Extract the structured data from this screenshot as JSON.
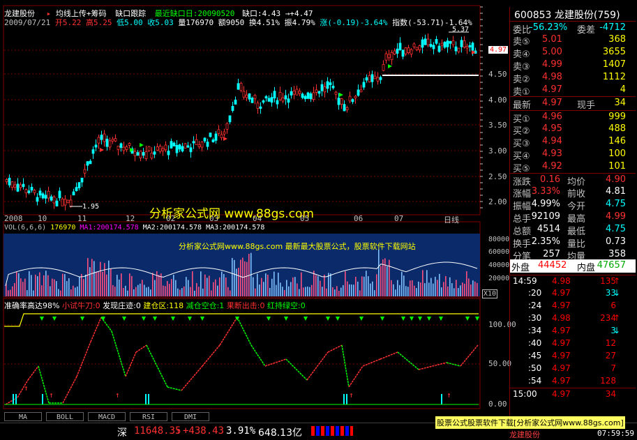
{
  "header": {
    "stock_name": "龙建股份",
    "formula": "均线上传+筹码",
    "gap_track": "缺口跟踪",
    "recent_gap_label": "最近缺口日:20090520",
    "gap_value": "缺口:4.43 →+4.47",
    "date": "2009/07/21",
    "open": "开5.22",
    "high": "高5.25",
    "low": "低5.00",
    "close": "收5.03",
    "volume": "量176970",
    "amount": "额9050",
    "turnover": "换4.51%",
    "amplitude": "振4.79%",
    "change": "涨(-0.19)-3.64%",
    "index": "指数(-53.71)-1.64%"
  },
  "price_axis": [
    "5.37",
    "4.97",
    "4.50",
    "4.00",
    "3.50",
    "3.00",
    "2.50",
    "2.00"
  ],
  "price_markers": {
    "high_label": "5.37",
    "low_label": "1.95",
    "current_tag": "4.97"
  },
  "time_axis": [
    "2008",
    "10",
    "11",
    "12",
    "02",
    "03",
    "04",
    "05",
    "06",
    "07",
    "日线"
  ],
  "watermark": {
    "main": "分析家公式网 www.88gs.com",
    "sub": "分析家公式网www.88gs.com 最新最大股票公式，股票软件下载网站"
  },
  "volume_panel": {
    "legend": {
      "vol": "VOL(6,6,6)",
      "vol_val": "176970",
      "ma1": "MA1:200174.578",
      "ma2": "MA2:200174.578",
      "ma3": "MA3:200174.578"
    },
    "axis": [
      "80000",
      "60000",
      "40000",
      "20000",
      "X10"
    ]
  },
  "indicator_panel": {
    "legend": {
      "title": "准确率高达98%",
      "a": "小试牛刀:0",
      "b": "发现庄迹:0",
      "c": "建仓区:118",
      "d": "减仓空仓:1",
      "e": "果断出击:0",
      "f": "红持绿空:0"
    },
    "axis": [
      "100.00",
      "50.00",
      "0.00"
    ]
  },
  "tabs": [
    "MA",
    "BOLL",
    "MACD",
    "RSI",
    "DMI"
  ],
  "quote": {
    "code_name": "600853 龙建股份(759)",
    "wei_bi_label": "委比",
    "wei_bi": "-56.23%",
    "wei_cha_label": "委差",
    "wei_cha": "-4712",
    "sells": [
      {
        "label": "卖⑤",
        "price": "5.01",
        "vol": "368"
      },
      {
        "label": "卖④",
        "price": "5.00",
        "vol": "3655"
      },
      {
        "label": "卖③",
        "price": "4.99",
        "vol": "1407"
      },
      {
        "label": "卖②",
        "price": "4.98",
        "vol": "1112"
      },
      {
        "label": "卖①",
        "price": "4.97",
        "vol": "4"
      }
    ],
    "latest_label": "最新",
    "latest": "4.97",
    "now_hand_label": "现手",
    "now_hand": "34",
    "buys": [
      {
        "label": "买①",
        "price": "4.96",
        "vol": "999"
      },
      {
        "label": "买②",
        "price": "4.95",
        "vol": "488"
      },
      {
        "label": "买③",
        "price": "4.94",
        "vol": "146"
      },
      {
        "label": "买④",
        "price": "4.93",
        "vol": "100"
      },
      {
        "label": "买⑤",
        "price": "4.92",
        "vol": "101"
      }
    ],
    "stats": [
      {
        "l1": "涨跌",
        "v1": "0.16",
        "l2": "均价",
        "v2": "4.90"
      },
      {
        "l1": "涨幅",
        "v1": "3.33%",
        "l2": "前收",
        "v2": "4.81"
      },
      {
        "l1": "振幅",
        "v1": "4.99%",
        "l2": "今开",
        "v2": "4.75"
      },
      {
        "l1": "总手",
        "v1": "92109",
        "l2": "最高",
        "v2": "4.99"
      },
      {
        "l1": "总额",
        "v1": "4514",
        "l2": "最低",
        "v2": "4.75"
      },
      {
        "l1": "换手",
        "v1": "2.35%",
        "l2": "量比",
        "v2": "0.73"
      },
      {
        "l1": "分笔",
        "v1": "257",
        "l2": "均量",
        "v2": "358"
      }
    ],
    "outer_label": "外盘",
    "outer": "44452",
    "inner_label": "内盘",
    "inner": "47657"
  },
  "ticks": [
    {
      "t": "14:59",
      "p": "4.98",
      "v": "135",
      "dir": "up"
    },
    {
      "t": ":20",
      "p": "4.97",
      "v": "33",
      "dir": "down"
    },
    {
      "t": ":24",
      "p": "4.97",
      "v": "6",
      "dir": ""
    },
    {
      "t": ":30",
      "p": "4.98",
      "v": "234",
      "dir": "up"
    },
    {
      "t": ":34",
      "p": "4.97",
      "v": "3",
      "dir": "down"
    },
    {
      "t": ":40",
      "p": "4.97",
      "v": "12",
      "dir": ""
    },
    {
      "t": ":45",
      "p": "4.97",
      "v": "27",
      "dir": ""
    },
    {
      "t": ":50",
      "p": "4.97",
      "v": "7",
      "dir": ""
    },
    {
      "t": ":54",
      "p": "4.97",
      "v": "128",
      "dir": ""
    },
    {
      "t": "15:00",
      "p": "4.97",
      "v": "34",
      "dir": ""
    }
  ],
  "status": {
    "market": "深",
    "index": "11648.35",
    "change": "+438.43",
    "pct": "3.91%",
    "amount": "648.13亿",
    "ad_banner": "股票公式股票软件下载[分析家公式网www.88gs.com]",
    "stock": "龙建股份",
    "clock": "07:59:59"
  }
}
